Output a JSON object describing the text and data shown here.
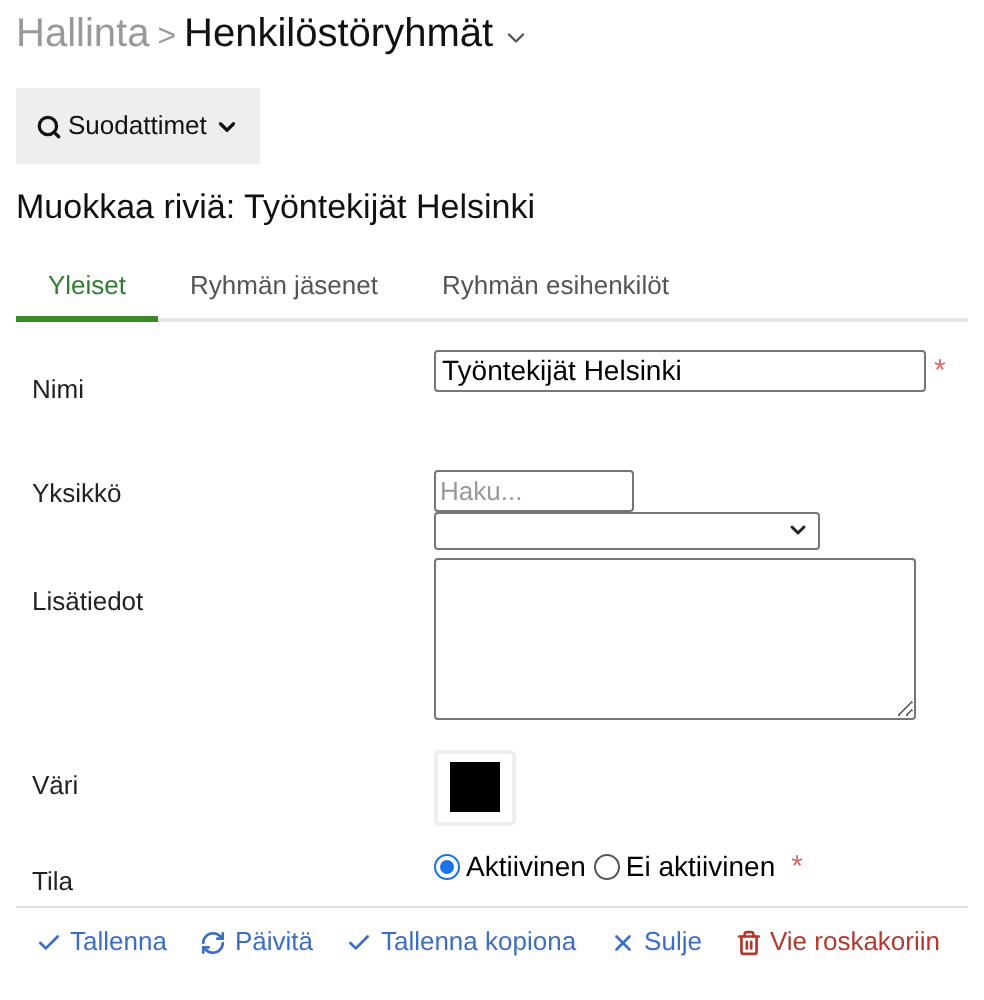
{
  "breadcrumb": {
    "parent": "Hallinta",
    "separator": ">",
    "current": "Henkilöstöryhmät"
  },
  "filter_button": {
    "label": "Suodattimet"
  },
  "heading": "Muokkaa riviä: Työntekijät Helsinki",
  "tabs": [
    {
      "label": "Yleiset",
      "selected": true
    },
    {
      "label": "Ryhmän jäsenet",
      "selected": false
    },
    {
      "label": "Ryhmän esihenkilöt",
      "selected": false
    }
  ],
  "form": [
    {
      "kind": "text",
      "label": "Nimi",
      "value": "Työntekijät Helsinki",
      "required": true
    },
    {
      "kind": "search-select",
      "label": "Yksikkö",
      "placeholder": "Haku...",
      "required": false
    },
    {
      "kind": "textarea",
      "label": "Lisätiedot",
      "required": false
    },
    {
      "kind": "color",
      "label": "Väri",
      "color": "#000000",
      "required": false
    },
    {
      "kind": "radio",
      "label": "Tila",
      "required": true,
      "options": [
        {
          "label": "Aktiivinen",
          "selected": true
        },
        {
          "label": "Ei aktiivinen",
          "selected": false
        }
      ]
    }
  ],
  "required_mark": "*",
  "actions": [
    {
      "kind": "check",
      "label": "Tallenna"
    },
    {
      "kind": "refresh",
      "label": "Päivitä"
    },
    {
      "kind": "check",
      "label": "Tallenna kopiona"
    },
    {
      "kind": "close",
      "label": "Sulje"
    },
    {
      "kind": "delete",
      "label": "Vie roskakoriin"
    }
  ]
}
